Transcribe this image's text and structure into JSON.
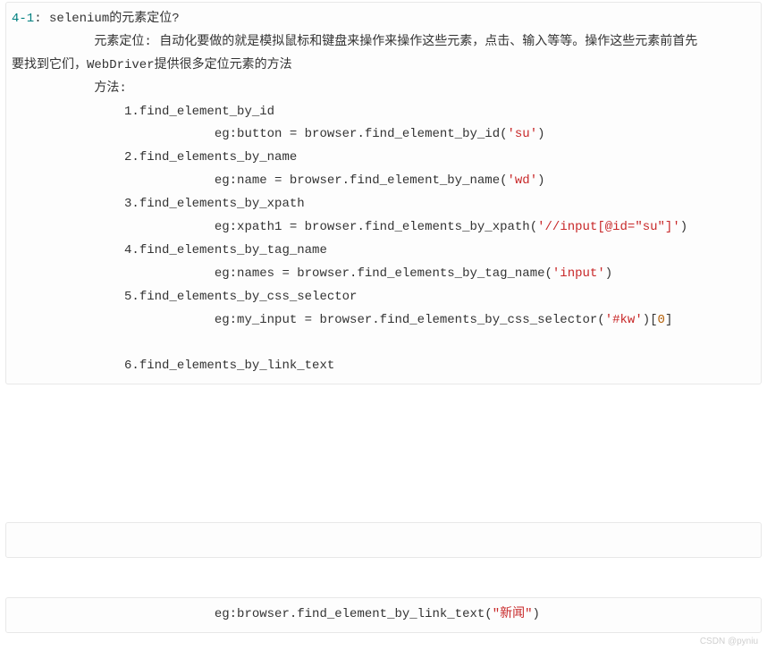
{
  "block1": {
    "heading_num": "4-1",
    "heading_rest": ": selenium的元素定位?",
    "intro_indent": "           元素定位: 自动化要做的就是模拟鼠标和键盘来操作来操作这些元素，点击、输入等等。操作这些元素前首先",
    "intro_line2": "要找到它们，WebDriver提供很多定位元素的方法",
    "methods_label": "           方法:",
    "m1": "               1.find_element_by_id",
    "m1_eg_pre": "                           eg:button = browser.find_element_by_id(",
    "m1_eg_str": "'su'",
    "m1_eg_post": ")",
    "m2": "               2.find_elements_by_name",
    "m2_eg_pre": "                           eg:name = browser.find_element_by_name(",
    "m2_eg_str": "'wd'",
    "m2_eg_post": ")",
    "m3": "               3.find_elements_by_xpath",
    "m3_eg_pre": "                           eg:xpath1 = browser.find_elements_by_xpath(",
    "m3_eg_str": "'//input[@id=\"su\"]'",
    "m3_eg_post": ")",
    "m4": "               4.find_elements_by_tag_name",
    "m4_eg_pre": "                           eg:names = browser.find_elements_by_tag_name(",
    "m4_eg_str": "'input'",
    "m4_eg_post": ")",
    "m5": "               5.find_elements_by_css_selector",
    "m5_eg_pre": "                           eg:my_input = browser.find_elements_by_css_selector(",
    "m5_eg_str": "'#kw'",
    "m5_eg_post": ")[",
    "m5_eg_idx": "0",
    "m5_eg_post2": "]",
    "m6": "               6.find_elements_by_link_text"
  },
  "block2": {
    "empty": " "
  },
  "block3": {
    "eg_pre": "                           eg:browser.find_element_by_link_text(",
    "eg_str": "\"新闻\"",
    "eg_post": ")"
  },
  "watermark": "CSDN @pyniu"
}
